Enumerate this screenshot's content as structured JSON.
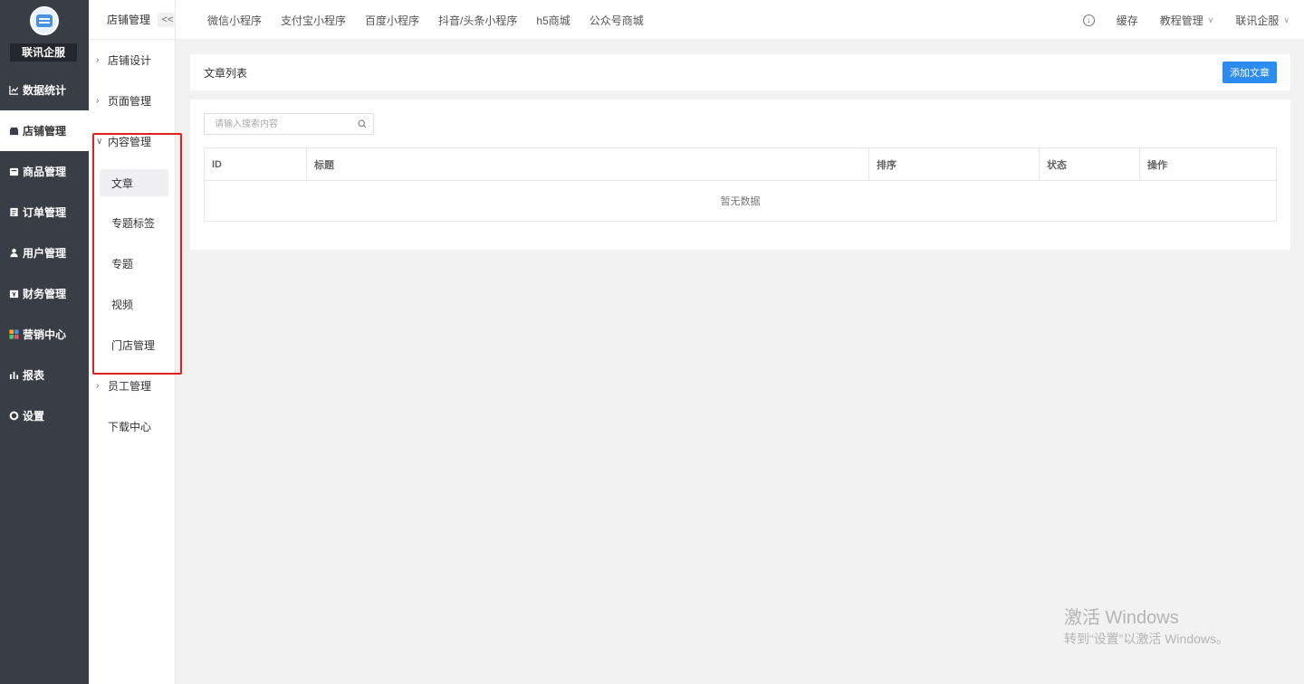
{
  "brand": {
    "name": "联讯企服"
  },
  "sidebar": {
    "items": [
      {
        "label": "数据统计",
        "icon": "line-chart-icon",
        "active": false
      },
      {
        "label": "店铺管理",
        "icon": "store-icon",
        "active": true
      },
      {
        "label": "商品管理",
        "icon": "goods-icon",
        "active": false
      },
      {
        "label": "订单管理",
        "icon": "order-icon",
        "active": false
      },
      {
        "label": "用户管理",
        "icon": "user-icon",
        "active": false
      },
      {
        "label": "财务管理",
        "icon": "finance-icon",
        "active": false
      },
      {
        "label": "营销中心",
        "icon": "marketing-icon",
        "active": false
      },
      {
        "label": "报表",
        "icon": "report-icon",
        "active": false
      },
      {
        "label": "设置",
        "icon": "settings-icon",
        "active": false
      }
    ]
  },
  "submenu": {
    "header": "店铺管理",
    "collapse_label": "<<",
    "groups": [
      {
        "label": "店铺设计",
        "expanded": false
      },
      {
        "label": "页面管理",
        "expanded": false
      },
      {
        "label": "内容管理",
        "expanded": true,
        "children": [
          {
            "label": "文章",
            "active": true
          },
          {
            "label": "专题标签",
            "active": false
          },
          {
            "label": "专题",
            "active": false
          },
          {
            "label": "视频",
            "active": false
          },
          {
            "label": "门店管理",
            "active": false
          }
        ]
      },
      {
        "label": "员工管理",
        "expanded": false
      },
      {
        "label": "下载中心",
        "expanded": false
      }
    ]
  },
  "topbar": {
    "tabs": [
      "微信小程序",
      "支付宝小程序",
      "百度小程序",
      "抖音/头条小程序",
      "h5商城",
      "公众号商城"
    ],
    "cache_label": "缓存",
    "tutorial_label": "教程管理",
    "account_label": "联讯企服"
  },
  "main": {
    "title": "文章列表",
    "add_button": "添加文章",
    "search_placeholder": "请输入搜索内容",
    "columns": [
      "ID",
      "标题",
      "排序",
      "状态",
      "操作"
    ],
    "empty_text": "暂无数据"
  },
  "watermark": {
    "line1": "激活 Windows",
    "line2": "转到“设置”以激活 Windows。"
  },
  "colors": {
    "sidebar_bg": "#393d45",
    "accent": "#2d8cf0",
    "highlight": "#e02020"
  }
}
